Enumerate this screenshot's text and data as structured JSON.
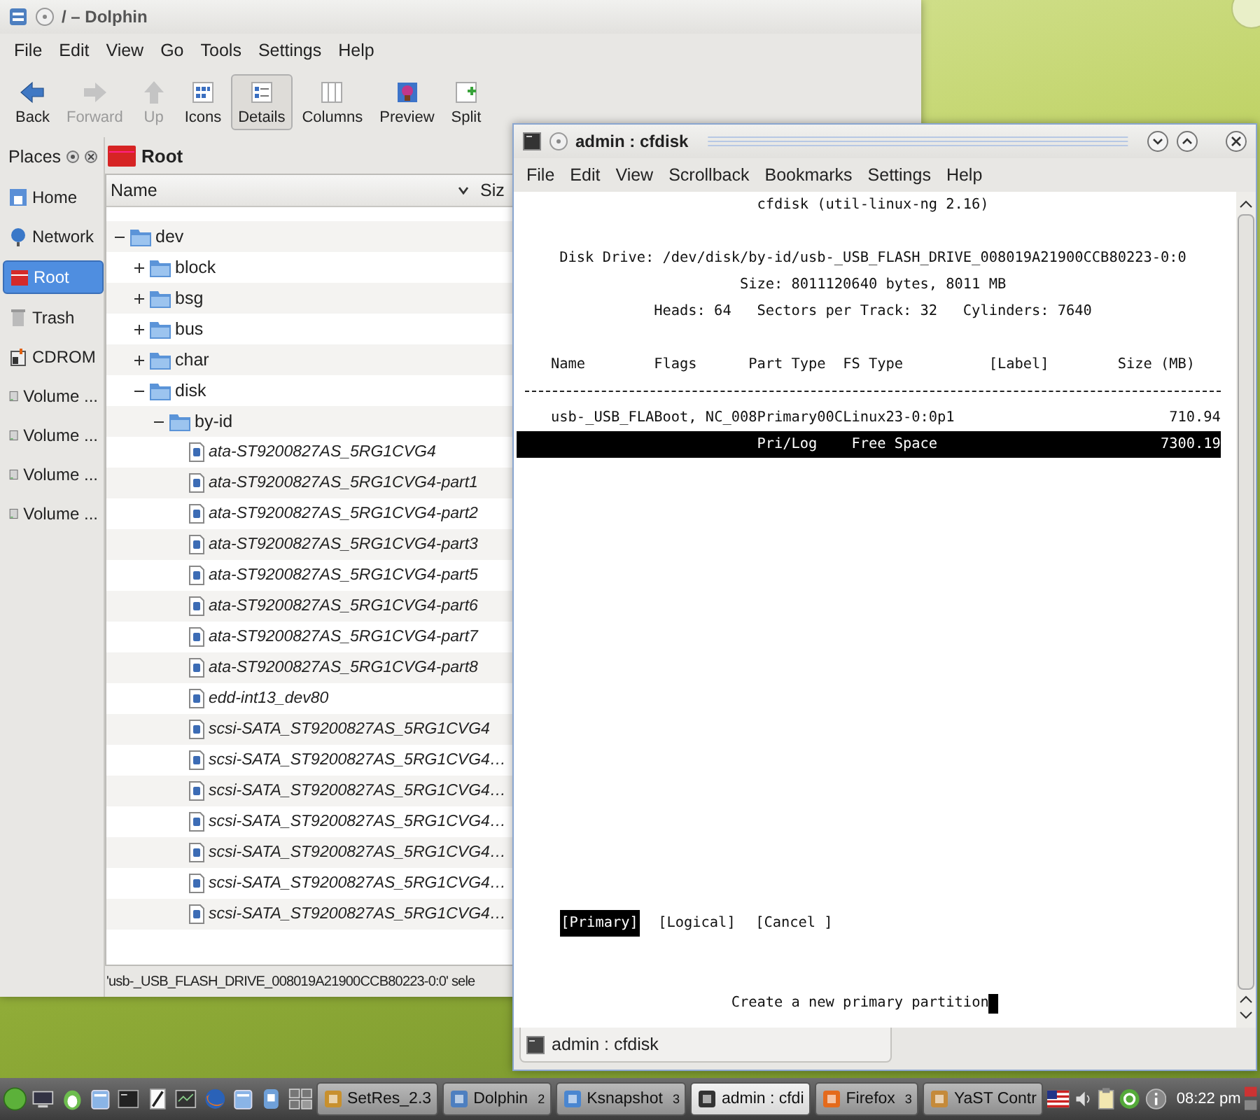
{
  "dolphin": {
    "title": "/ – Dolphin",
    "menu": [
      "File",
      "Edit",
      "View",
      "Go",
      "Tools",
      "Settings",
      "Help"
    ],
    "toolbar": [
      {
        "label": "Back",
        "disabled": false,
        "selected": false
      },
      {
        "label": "Forward",
        "disabled": true,
        "selected": false
      },
      {
        "label": "Up",
        "disabled": true,
        "selected": false
      },
      {
        "label": "Icons",
        "disabled": false,
        "selected": false
      },
      {
        "label": "Details",
        "disabled": false,
        "selected": true
      },
      {
        "label": "Columns",
        "disabled": false,
        "selected": false
      },
      {
        "label": "Preview",
        "disabled": false,
        "selected": false
      },
      {
        "label": "Split",
        "disabled": false,
        "selected": false
      }
    ],
    "places": {
      "title": "Places",
      "items": [
        {
          "label": "Home",
          "selected": false
        },
        {
          "label": "Network",
          "selected": false
        },
        {
          "label": "Root",
          "selected": true
        },
        {
          "label": "Trash",
          "selected": false
        },
        {
          "label": "CDROM",
          "selected": false
        },
        {
          "label": "Volume ...",
          "selected": false
        },
        {
          "label": "Volume ...",
          "selected": false
        },
        {
          "label": "Volume ...",
          "selected": false
        },
        {
          "label": "Volume ...",
          "selected": false
        }
      ]
    },
    "location": "Root",
    "columns": [
      "Name",
      "Siz"
    ],
    "tree": [
      {
        "label": "dev",
        "kind": "folder",
        "expanded": true,
        "children": [
          {
            "label": "block",
            "kind": "folder",
            "expanded": false
          },
          {
            "label": "bsg",
            "kind": "folder",
            "expanded": false
          },
          {
            "label": "bus",
            "kind": "folder",
            "expanded": false
          },
          {
            "label": "char",
            "kind": "folder",
            "expanded": false
          },
          {
            "label": "disk",
            "kind": "folder",
            "expanded": true,
            "children": [
              {
                "label": "by-id",
                "kind": "folder",
                "expanded": true,
                "children": [
                  {
                    "label": "ata-ST9200827AS_5RG1CVG4",
                    "kind": "link"
                  },
                  {
                    "label": "ata-ST9200827AS_5RG1CVG4-part1",
                    "kind": "link"
                  },
                  {
                    "label": "ata-ST9200827AS_5RG1CVG4-part2",
                    "kind": "link"
                  },
                  {
                    "label": "ata-ST9200827AS_5RG1CVG4-part3",
                    "kind": "link"
                  },
                  {
                    "label": "ata-ST9200827AS_5RG1CVG4-part5",
                    "kind": "link"
                  },
                  {
                    "label": "ata-ST9200827AS_5RG1CVG4-part6",
                    "kind": "link"
                  },
                  {
                    "label": "ata-ST9200827AS_5RG1CVG4-part7",
                    "kind": "link"
                  },
                  {
                    "label": "ata-ST9200827AS_5RG1CVG4-part8",
                    "kind": "link"
                  },
                  {
                    "label": "edd-int13_dev80",
                    "kind": "link"
                  },
                  {
                    "label": "scsi-SATA_ST9200827AS_5RG1CVG4",
                    "kind": "link"
                  },
                  {
                    "label": "scsi-SATA_ST9200827AS_5RG1CVG4…",
                    "kind": "link"
                  },
                  {
                    "label": "scsi-SATA_ST9200827AS_5RG1CVG4…",
                    "kind": "link"
                  },
                  {
                    "label": "scsi-SATA_ST9200827AS_5RG1CVG4…",
                    "kind": "link"
                  },
                  {
                    "label": "scsi-SATA_ST9200827AS_5RG1CVG4…",
                    "kind": "link"
                  },
                  {
                    "label": "scsi-SATA_ST9200827AS_5RG1CVG4…",
                    "kind": "link"
                  },
                  {
                    "label": "scsi-SATA_ST9200827AS_5RG1CVG4…",
                    "kind": "link"
                  }
                ]
              }
            ]
          }
        ]
      }
    ],
    "status": "'usb-_USB_FLASH_DRIVE_008019A21900CCB80223-0:0' sele"
  },
  "konsole": {
    "title": "admin : cfdisk",
    "menu": [
      "File",
      "Edit",
      "View",
      "Scrollback",
      "Bookmarks",
      "Settings",
      "Help"
    ],
    "terminal": {
      "heading": "cfdisk (util-linux-ng 2.16)",
      "disk_info": [
        "Disk Drive: /dev/disk/by-id/usb-_USB_FLASH_DRIVE_008019A21900CCB80223-0:0",
        "Size: 8011120640 bytes, 8011 MB",
        "Heads: 64   Sectors per Track: 32   Cylinders: 7640"
      ],
      "column_header": "Name        Flags      Part Type  FS Type          [Label]        Size (MB)",
      "partitions": [
        {
          "name": "usb-_USB_FLABoot, NC_008Primary00CLinux23-0:0p1",
          "size": "710.94",
          "selected": false
        },
        {
          "part_type": "Pri/Log",
          "fs_type": "Free Space",
          "size": "7300.19",
          "selected": true
        }
      ],
      "actions": [
        {
          "label": "[Primary]",
          "selected": true
        },
        {
          "label": "[Logical]",
          "selected": false
        },
        {
          "label": "[Cancel ]",
          "selected": false
        }
      ],
      "message": "Create a new primary partition"
    },
    "tab": "admin : cfdisk"
  },
  "taskbar": {
    "tasks": [
      {
        "label": "SetRes_2.3",
        "selected": false
      },
      {
        "label": "Dolphin",
        "count": "2",
        "selected": false
      },
      {
        "label": "Ksnapshot",
        "count": "3",
        "selected": false
      },
      {
        "label": "admin : cfdi",
        "selected": true
      },
      {
        "label": "Firefox",
        "count": "3",
        "selected": false
      },
      {
        "label": "YaST Contr",
        "selected": false
      }
    ],
    "clock": "08:22 pm"
  }
}
